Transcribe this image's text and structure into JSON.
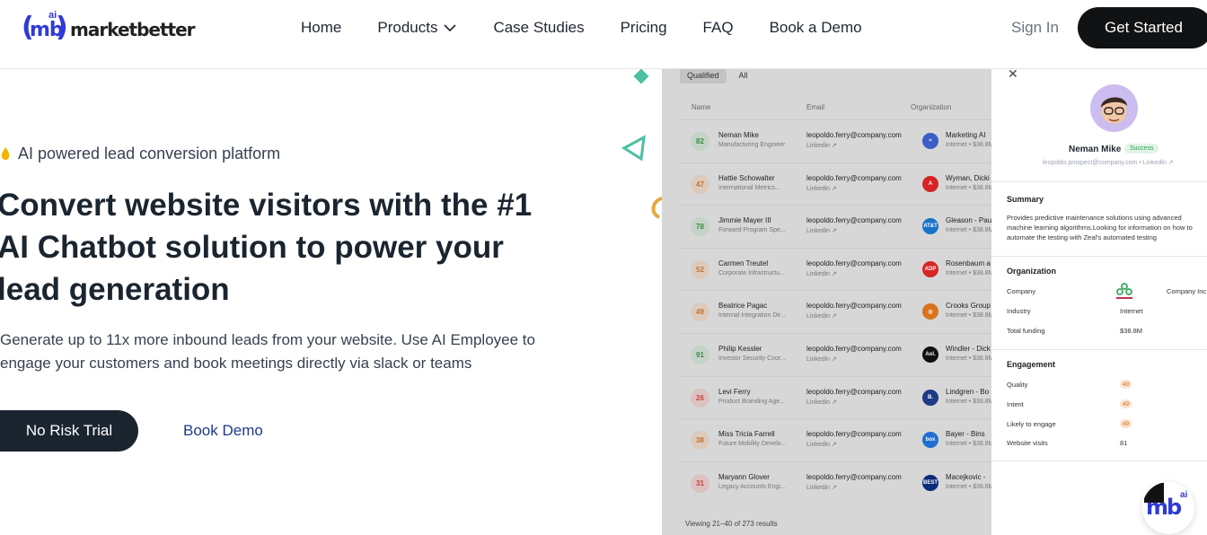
{
  "brand": {
    "logo_mark": "mb",
    "logo_ai": "ai",
    "logo_text": "marketbetter"
  },
  "nav": {
    "items": [
      {
        "label": "Home"
      },
      {
        "label": "Products",
        "has_dropdown": true
      },
      {
        "label": "Case Studies"
      },
      {
        "label": "Pricing"
      },
      {
        "label": "FAQ"
      },
      {
        "label": "Book a Demo"
      }
    ],
    "sign_in": "Sign In",
    "get_started": "Get Started"
  },
  "hero": {
    "eyebrow": "AI powered lead conversion platform",
    "title": "Convert website visitors with the #1 AI Chatbot solution to power your lead generation",
    "subtitle": "Generate up to 11x more inbound leads from your website. Use AI Employee to engage your customers and book meetings directly via slack or teams",
    "primary_cta": "No Risk Trial",
    "secondary_cta": "Book Demo"
  },
  "dashboard": {
    "tabs": [
      "Qualified",
      "All"
    ],
    "columns": [
      "Name",
      "Email",
      "Organization"
    ],
    "rows": [
      {
        "score": "82",
        "level": "green",
        "name": "Neman Mike",
        "title": "Manufacturing Engineer",
        "email": "leopoldo.ferry@company.com",
        "link": "Linkedin ↗",
        "org": "Marketing AI",
        "org_sub": "Internet  •  $38.8M"
      },
      {
        "score": "47",
        "level": "orange",
        "name": "Hattie Schowalter",
        "title": "International Metrics...",
        "email": "leopoldo.ferry@company.com",
        "link": "Linkedin ↗",
        "org": "Wyman, Dicki",
        "org_sub": "Internet  •  $38.8M"
      },
      {
        "score": "78",
        "level": "green",
        "name": "Jimmie Mayer III",
        "title": "Forward Program Spe...",
        "email": "leopoldo.ferry@company.com",
        "link": "Linkedin ↗",
        "org": "Gleason - Pau",
        "org_sub": "Internet  •  $38.8M"
      },
      {
        "score": "52",
        "level": "orange",
        "name": "Carmen Treutel",
        "title": "Corporate Infrastructu...",
        "email": "leopoldo.ferry@company.com",
        "link": "Linkedin ↗",
        "org": "Rosenbaum a",
        "org_sub": "Internet  •  $38.8M"
      },
      {
        "score": "49",
        "level": "orange",
        "name": "Beatrice Pagac",
        "title": "Internal Integration Dir...",
        "email": "leopoldo.ferry@company.com",
        "link": "Linkedin ↗",
        "org": "Crooks Group",
        "org_sub": "Internet  •  $38.8M"
      },
      {
        "score": "91",
        "level": "green",
        "name": "Philip Kessler",
        "title": "Investor Security Coor...",
        "email": "leopoldo.ferry@company.com",
        "link": "Linkedin ↗",
        "org": "Windler - Dick",
        "org_sub": "Internet  •  $38.8M"
      },
      {
        "score": "26",
        "level": "red",
        "name": "Levi Ferry",
        "title": "Product Branding Age...",
        "email": "leopoldo.ferry@company.com",
        "link": "Linkedin ↗",
        "org": "Lindgren - Bo",
        "org_sub": "Internet  •  $38.8M"
      },
      {
        "score": "38",
        "level": "orange",
        "name": "Miss Tricia Farrell",
        "title": "Future Mobility Develo...",
        "email": "leopoldo.ferry@company.com",
        "link": "Linkedin ↗",
        "org": "Bayer - Bins",
        "org_sub": "Internet  •  $38.8M"
      },
      {
        "score": "31",
        "level": "red",
        "name": "Maryann Glover",
        "title": "Legacy Accounts Engi...",
        "email": "leopoldo.ferry@company.com",
        "link": "Linkedin ↗",
        "org": "Macejkovic -",
        "org_sub": "Internet  •  $38.8M"
      }
    ],
    "org_logos": [
      {
        "text": "≈",
        "color": "#3b5fc7"
      },
      {
        "text": "A",
        "color": "#d62525"
      },
      {
        "text": "AT&T",
        "color": "#1a73c9"
      },
      {
        "text": "ADP",
        "color": "#d62525"
      },
      {
        "text": "◎",
        "color": "#d8741c"
      },
      {
        "text": "Aol.",
        "color": "#111111"
      },
      {
        "text": "B.",
        "color": "#1f3a86"
      },
      {
        "text": "box",
        "color": "#1f6fd1"
      },
      {
        "text": "BEST",
        "color": "#0a2a7a"
      }
    ],
    "footer": "Viewing 21–40 of 273 results"
  },
  "profile": {
    "close": "✕",
    "name": "Neman Mike",
    "status": "Success",
    "email_line": "leopoldo.prospect@company.com  •  Linkedin ↗",
    "summary_title": "Summary",
    "summary": "Provides predictive maintenance solutions using advanced machine learning algorithms.Looking for information on how to automate the testing with Zeal's automated testing",
    "organization_title": "Organization",
    "company_label": "Company",
    "company_value": "Company Inc",
    "industry_label": "Industry",
    "industry_value": "Internet",
    "funding_label": "Total funding",
    "funding_value": "$38.8M",
    "engagement_title": "Engagement",
    "quality_label": "Quality",
    "quality_value": "49",
    "intent_label": "Intent",
    "intent_value": "49",
    "likely_label": "Likely to engage",
    "likely_value": "49",
    "visits_label": "Website visits",
    "visits_value": "81"
  },
  "colors": {
    "brand_blue": "#2f3bd6",
    "dark": "#1b2530",
    "teal_accent": "#4cc0a0"
  }
}
